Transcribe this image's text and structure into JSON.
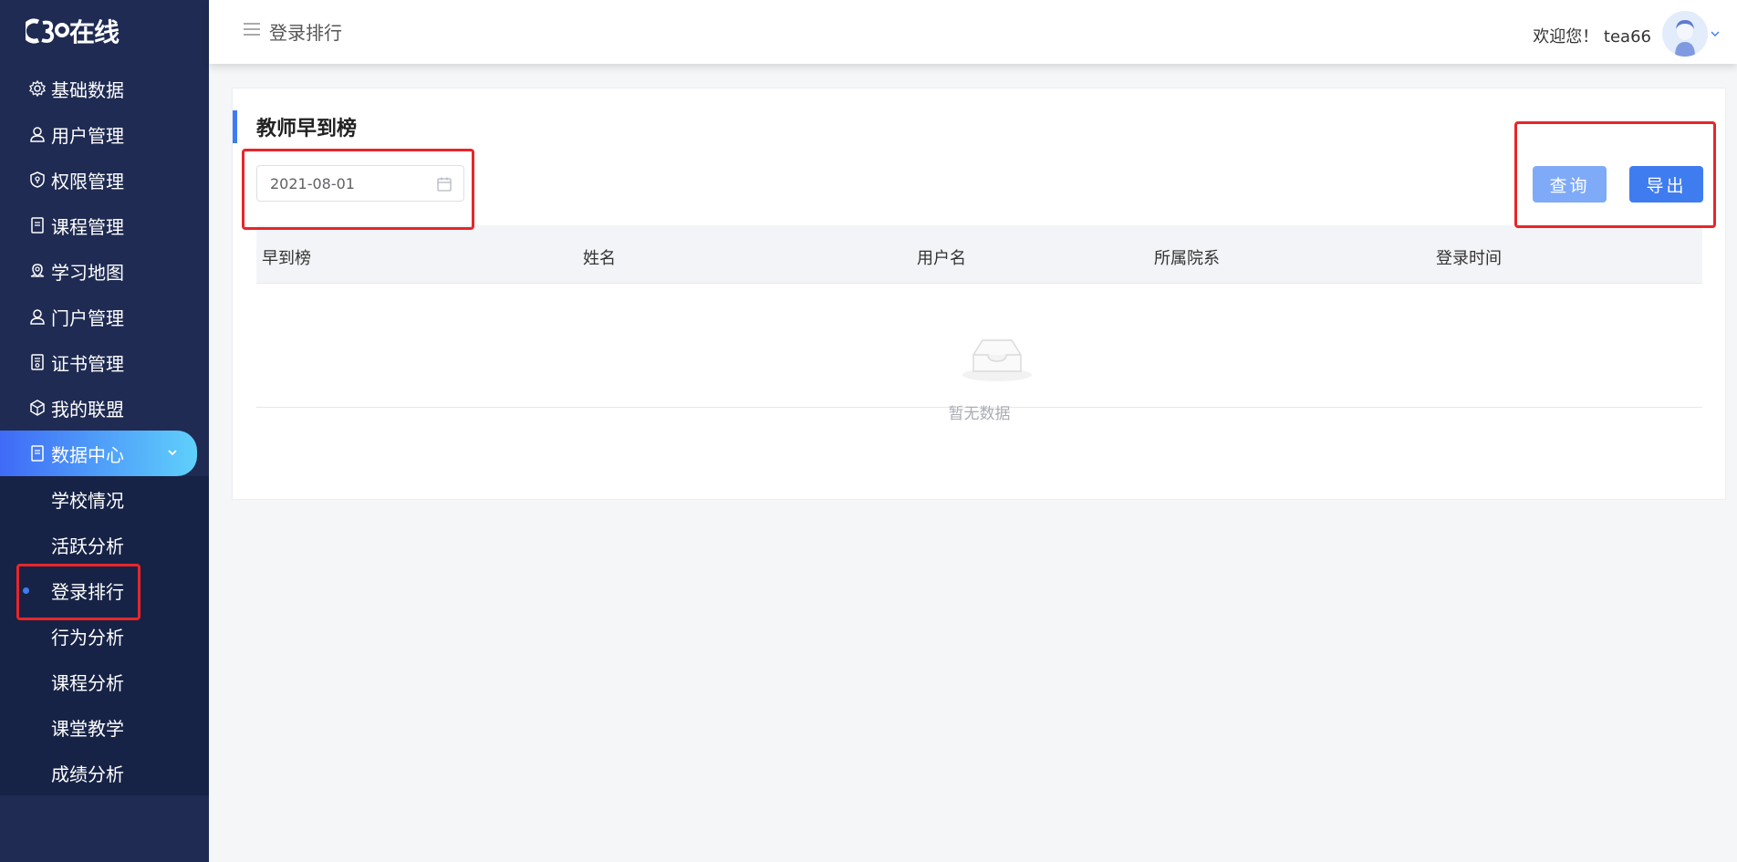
{
  "app": {
    "logo_text": "在线",
    "logo_mark": "C3O"
  },
  "sidebar": {
    "items": [
      {
        "label": "基础数据",
        "icon": "gear-icon"
      },
      {
        "label": "用户管理",
        "icon": "user-icon"
      },
      {
        "label": "权限管理",
        "icon": "shield-icon"
      },
      {
        "label": "课程管理",
        "icon": "document-icon"
      },
      {
        "label": "学习地图",
        "icon": "map-pin-icon"
      },
      {
        "label": "门户管理",
        "icon": "user-icon"
      },
      {
        "label": "证书管理",
        "icon": "certificate-icon"
      },
      {
        "label": "我的联盟",
        "icon": "cube-icon"
      },
      {
        "label": "数据中心",
        "icon": "document-icon"
      }
    ],
    "subitems": [
      {
        "label": "学校情况"
      },
      {
        "label": "活跃分析"
      },
      {
        "label": "登录排行"
      },
      {
        "label": "行为分析"
      },
      {
        "label": "课程分析"
      },
      {
        "label": "课堂教学"
      },
      {
        "label": "成绩分析"
      }
    ]
  },
  "header": {
    "breadcrumb": "登录排行",
    "welcome": "欢迎您！ tea66"
  },
  "card": {
    "title": "教师早到榜",
    "date_value": "2021-08-01",
    "query_label": "查询",
    "export_label": "导出"
  },
  "table": {
    "columns": [
      "早到榜",
      "姓名",
      "用户名",
      "所属院系",
      "登录时间"
    ],
    "rows": [],
    "empty_text": "暂无数据"
  },
  "colors": {
    "sidebar_bg": "#1f2b52",
    "accent": "#3f7cf0",
    "highlight_box": "#e8252a"
  }
}
